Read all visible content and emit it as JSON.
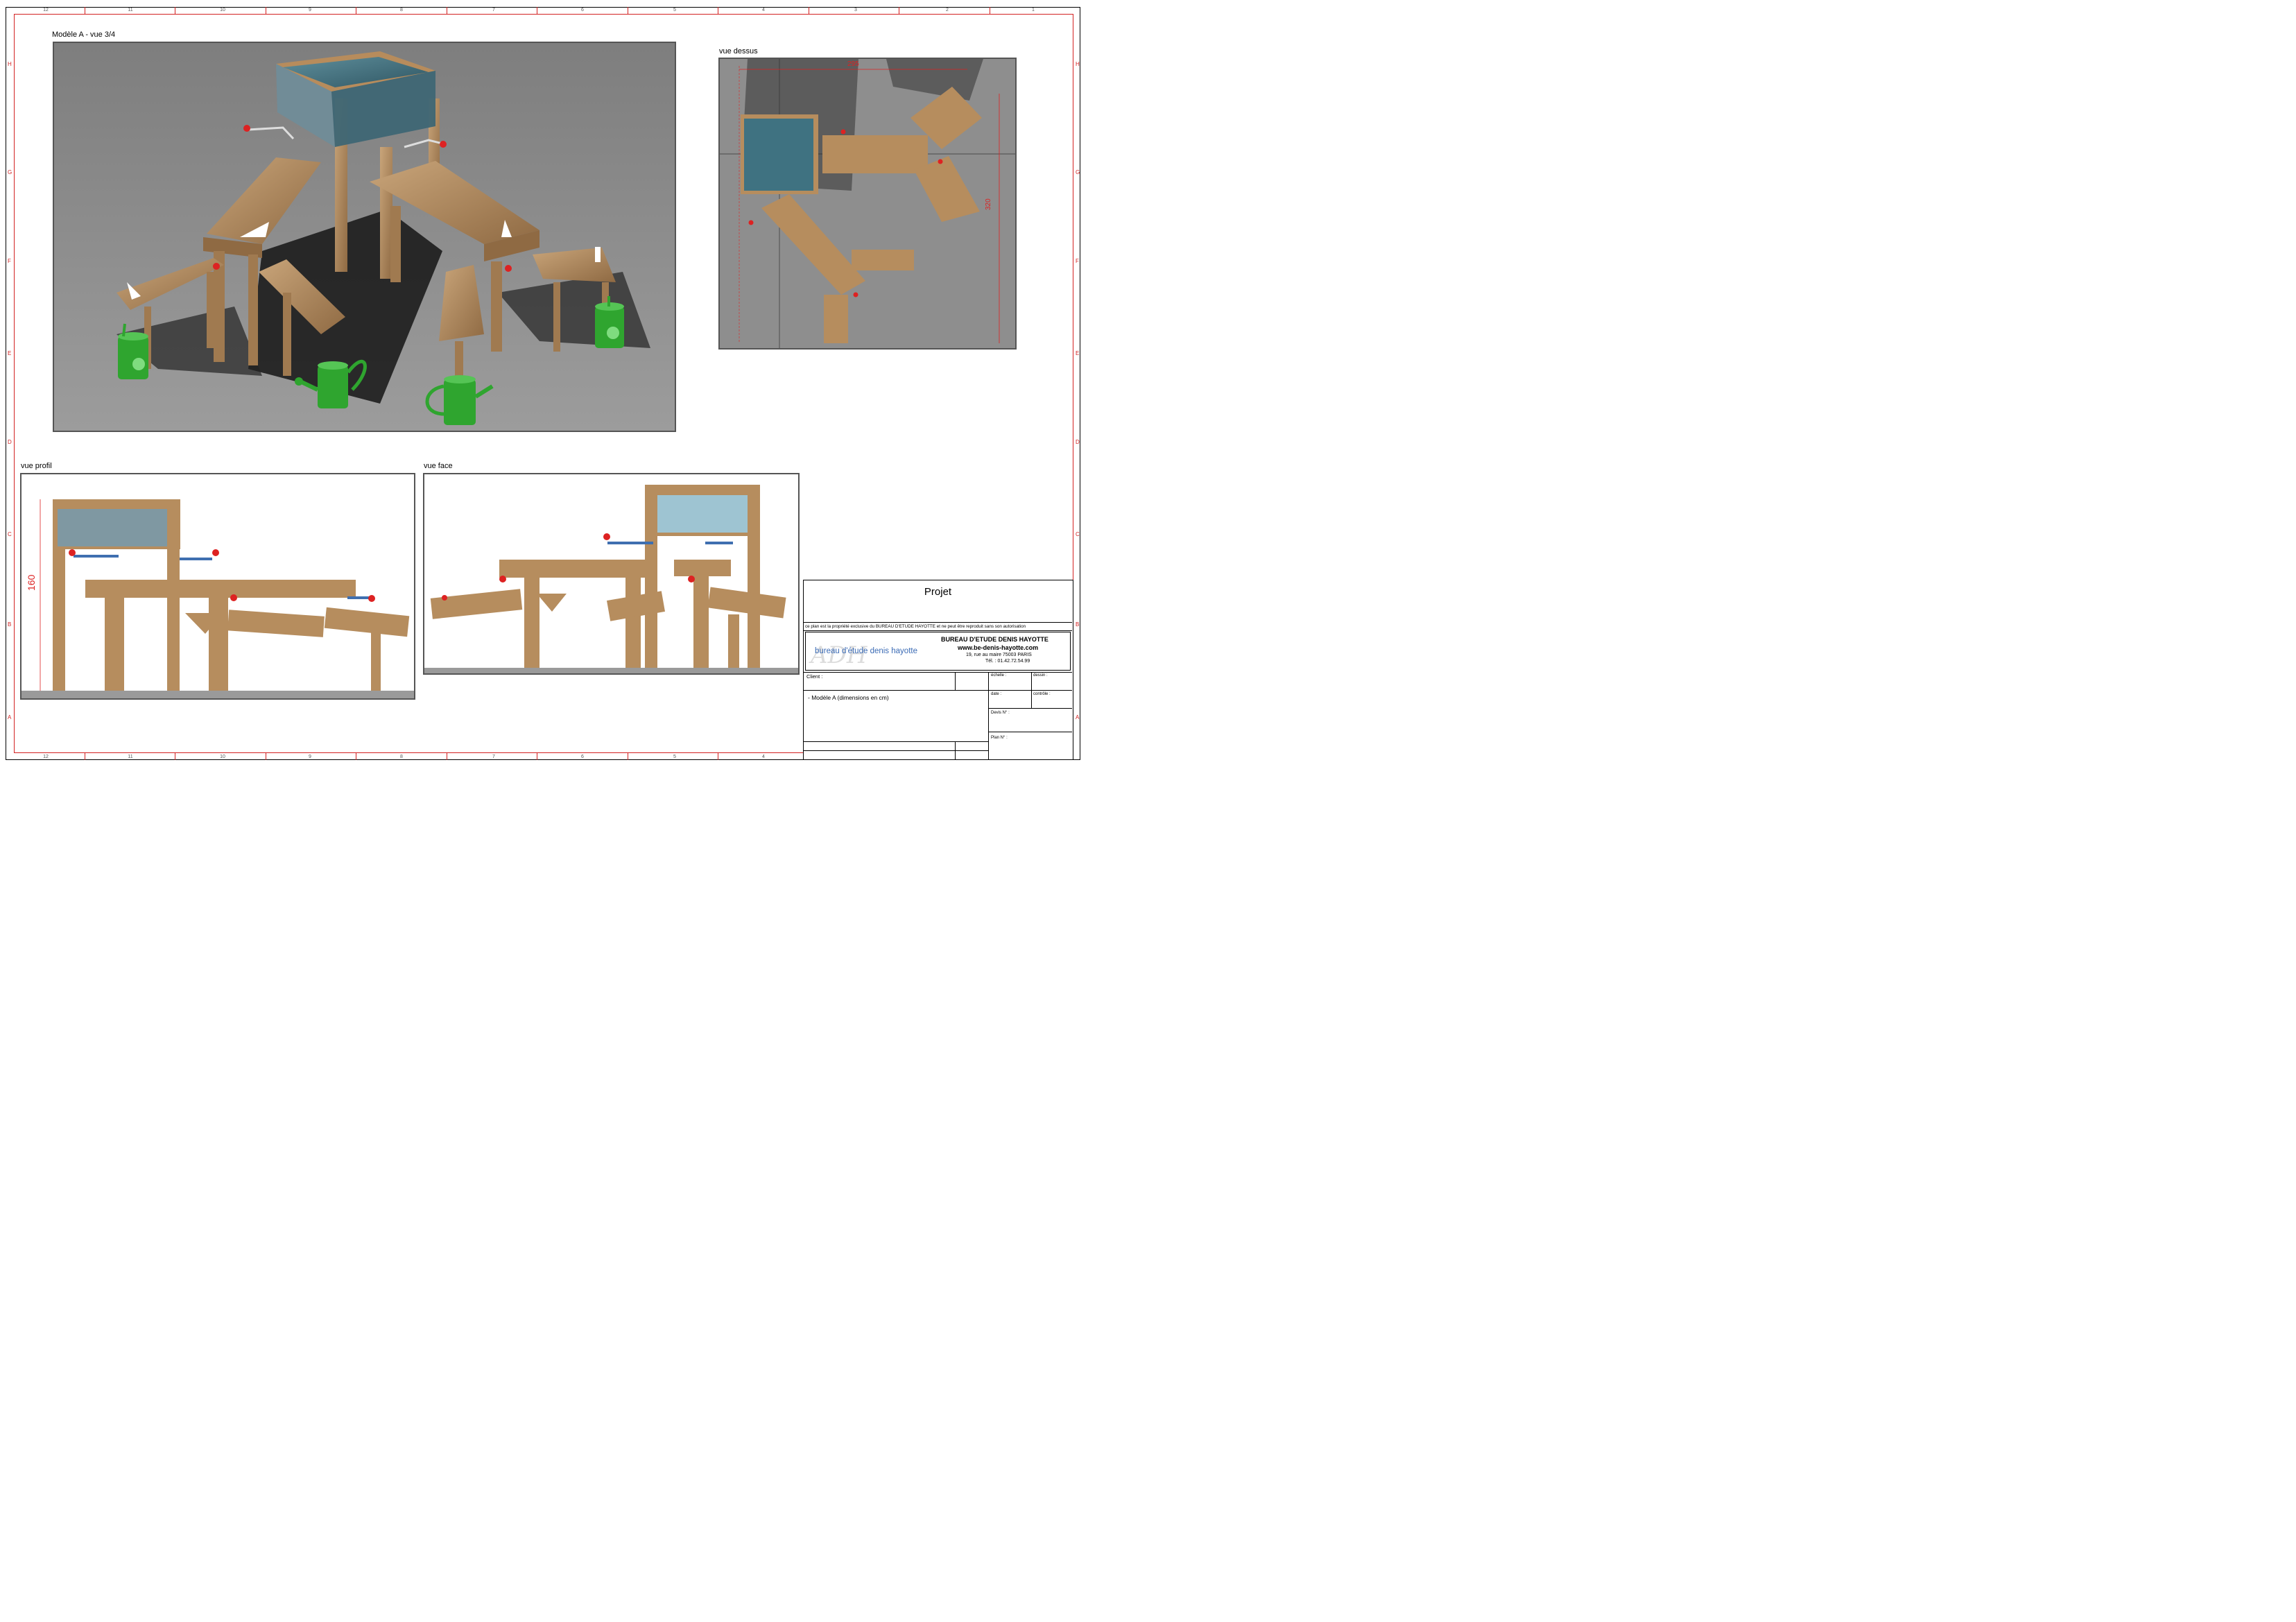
{
  "border": {
    "columns": [
      "12",
      "11",
      "10",
      "9",
      "8",
      "7",
      "6",
      "5",
      "4",
      "3",
      "2",
      "1"
    ],
    "rows": [
      "H",
      "G",
      "F",
      "E",
      "D",
      "C",
      "B",
      "A"
    ]
  },
  "views": {
    "iso": {
      "label": "Modèle A - vue 3/4"
    },
    "top": {
      "label": "vue dessus",
      "dim_width": "295",
      "dim_depth": "320"
    },
    "profile": {
      "label": "vue profil",
      "dim_height": "160"
    },
    "front": {
      "label": "vue face"
    }
  },
  "title_block": {
    "projet": "Projet",
    "notice": "ce plan est la propriété exclusive du BUREAU D'ETUDE HAYOTTE et ne peut être reproduit sans son autorisation",
    "logo_text": "bureau d'étude denis hayotte",
    "company": "BUREAU D'ETUDE DENIS HAYOTTE",
    "website": "www.be-denis-hayotte.com",
    "address": "19, rue au maire 75003 PARIS",
    "phone": "Tél. : 01.42.72.54.99",
    "client_label": "Client :",
    "echelle_label": "échelle :",
    "dessin_label": "dessin :",
    "date_label": "date :",
    "controle_label": "contrôle :",
    "devis_label": "Devis N° :",
    "plan_label": "Plan N° :",
    "description": "- Modèle A (dimensions en cm)"
  },
  "colors": {
    "frame_red": "#d32020",
    "render_grey": "#8c8c8c",
    "wood": "#b08a60",
    "water": "#4a7a88",
    "can_green": "#2fa52f"
  }
}
